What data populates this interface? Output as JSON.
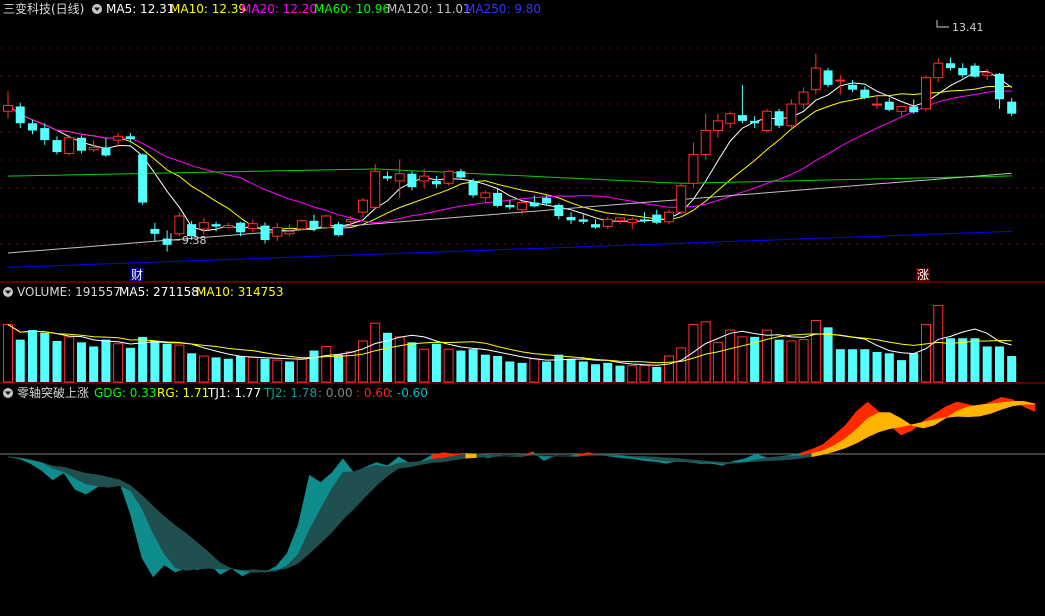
{
  "main_header": {
    "title": "三变科技(日线)",
    "items": [
      {
        "label": "MA5: 12.31",
        "color": "#ffffff"
      },
      {
        "label": "MA10: 12.39",
        "color": "#ffff00"
      },
      {
        "label": "MA20: 12.20",
        "color": "#ff00ff"
      },
      {
        "label": "MA60: 10.96",
        "color": "#00ff00"
      },
      {
        "label": "MA120: 11.01",
        "color": "#c0c0c0"
      },
      {
        "label": "MA250: 9.80",
        "color": "#0000ff"
      }
    ]
  },
  "volume_header": {
    "title": "VOLUME: 191557",
    "items": [
      {
        "label": "MA5: 271158",
        "color": "#ffffff"
      },
      {
        "label": "MA10: 314753",
        "color": "#ffff00"
      }
    ]
  },
  "indicator_header": {
    "title": "零轴突破上涨",
    "items": [
      {
        "label": "GDG: 0.33",
        "color": "#00ff00"
      },
      {
        "label": "RG: 1.71",
        "color": "#ffff00"
      },
      {
        "label": "TJ1: 1.77",
        "color": "#ffffff"
      },
      {
        "label": "TJ2: 1.78",
        "color": "#008080"
      },
      {
        "label": ": 0.00",
        "color": "#808080"
      },
      {
        "label": ": 0.60",
        "color": "#ff0000"
      },
      {
        "label": ": -0.60",
        "color": "#00c0c0"
      }
    ]
  },
  "markers": {
    "low_label": "9.38",
    "high_label": "13.41",
    "event_cai": "财",
    "event_zhang": "涨"
  },
  "colors": {
    "up": "#ff3030",
    "down": "#54ffff",
    "grid": "#7a0000",
    "frame": "#b00000",
    "zero": "#808080"
  },
  "chart_data": {
    "type": "candlestick",
    "price_range": [
      9.1,
      14.2
    ],
    "candles": [
      [
        12.3,
        12.72,
        12.15,
        12.42
      ],
      [
        12.4,
        12.48,
        11.95,
        12.05
      ],
      [
        12.05,
        12.12,
        11.82,
        11.9
      ],
      [
        11.95,
        12.05,
        11.6,
        11.7
      ],
      [
        11.7,
        11.78,
        11.4,
        11.45
      ],
      [
        11.42,
        11.82,
        11.38,
        11.75
      ],
      [
        11.75,
        11.8,
        11.42,
        11.48
      ],
      [
        11.5,
        11.7,
        11.45,
        11.55
      ],
      [
        11.55,
        11.75,
        11.35,
        11.38
      ],
      [
        11.7,
        11.85,
        11.55,
        11.78
      ],
      [
        11.78,
        11.85,
        11.65,
        11.72
      ],
      [
        11.4,
        11.42,
        10.35,
        10.4
      ],
      [
        9.85,
        9.98,
        9.6,
        9.75
      ],
      [
        9.65,
        9.82,
        9.38,
        9.52
      ],
      [
        9.75,
        10.2,
        9.7,
        10.12
      ],
      [
        9.95,
        10.02,
        9.62,
        9.7
      ],
      [
        9.85,
        10.08,
        9.72,
        9.98
      ],
      [
        9.95,
        10.0,
        9.8,
        9.9
      ],
      [
        9.88,
        9.98,
        9.85,
        9.92
      ],
      [
        9.98,
        10.0,
        9.7,
        9.78
      ],
      [
        9.86,
        10.05,
        9.78,
        9.96
      ],
      [
        9.92,
        9.99,
        9.55,
        9.62
      ],
      [
        9.7,
        9.98,
        9.6,
        9.88
      ],
      [
        9.75,
        9.95,
        9.7,
        9.8
      ],
      [
        9.85,
        10.05,
        9.82,
        10.02
      ],
      [
        10.02,
        10.15,
        9.8,
        9.85
      ],
      [
        9.88,
        10.15,
        9.85,
        10.12
      ],
      [
        9.95,
        10.0,
        9.7,
        9.72
      ],
      [
        10.0,
        10.12,
        9.9,
        10.05
      ],
      [
        10.2,
        10.5,
        10.1,
        10.45
      ],
      [
        10.3,
        11.2,
        10.25,
        11.05
      ],
      [
        10.95,
        11.05,
        10.85,
        10.9
      ],
      [
        10.85,
        11.3,
        10.5,
        11.0
      ],
      [
        11.0,
        11.05,
        10.65,
        10.72
      ],
      [
        10.85,
        11.1,
        10.7,
        10.95
      ],
      [
        10.85,
        10.95,
        10.7,
        10.78
      ],
      [
        10.8,
        11.08,
        10.75,
        11.05
      ],
      [
        11.05,
        11.1,
        10.9,
        10.92
      ],
      [
        10.85,
        10.9,
        10.5,
        10.55
      ],
      [
        10.5,
        10.65,
        10.4,
        10.6
      ],
      [
        10.6,
        10.7,
        10.3,
        10.33
      ],
      [
        10.35,
        10.45,
        10.25,
        10.3
      ],
      [
        10.25,
        10.42,
        10.15,
        10.4
      ],
      [
        10.4,
        10.55,
        10.3,
        10.32
      ],
      [
        10.5,
        10.55,
        10.35,
        10.38
      ],
      [
        10.35,
        10.38,
        10.05,
        10.12
      ],
      [
        10.1,
        10.2,
        9.95,
        10.03
      ],
      [
        10.05,
        10.15,
        9.95,
        10.0
      ],
      [
        9.95,
        10.05,
        9.85,
        9.88
      ],
      [
        9.9,
        10.1,
        9.85,
        10.05
      ],
      [
        10.02,
        10.1,
        9.95,
        10.08
      ],
      [
        9.98,
        10.1,
        9.85,
        10.05
      ],
      [
        10.05,
        10.2,
        9.98,
        10.02
      ],
      [
        10.15,
        10.25,
        9.95,
        9.98
      ],
      [
        10.0,
        10.25,
        9.95,
        10.2
      ],
      [
        10.2,
        10.8,
        10.15,
        10.75
      ],
      [
        10.8,
        11.65,
        10.7,
        11.4
      ],
      [
        11.4,
        12.25,
        11.3,
        11.9
      ],
      [
        11.9,
        12.25,
        11.75,
        12.1
      ],
      [
        12.05,
        12.3,
        11.95,
        12.25
      ],
      [
        12.22,
        12.85,
        12.05,
        12.1
      ],
      [
        12.1,
        12.2,
        11.95,
        12.05
      ],
      [
        11.9,
        12.35,
        11.85,
        12.3
      ],
      [
        12.3,
        12.35,
        11.95,
        12.0
      ],
      [
        12.0,
        12.55,
        11.95,
        12.45
      ],
      [
        12.45,
        12.8,
        12.35,
        12.7
      ],
      [
        12.75,
        13.5,
        12.65,
        13.2
      ],
      [
        13.15,
        13.2,
        12.8,
        12.85
      ],
      [
        12.95,
        13.05,
        12.65,
        12.95
      ],
      [
        12.85,
        12.95,
        12.7,
        12.75
      ],
      [
        12.75,
        12.82,
        12.55,
        12.58
      ],
      [
        12.45,
        12.6,
        12.35,
        12.45
      ],
      [
        12.5,
        12.58,
        12.3,
        12.33
      ],
      [
        12.3,
        12.42,
        12.2,
        12.4
      ],
      [
        12.4,
        12.55,
        12.25,
        12.28
      ],
      [
        12.35,
        13.05,
        12.3,
        13.0
      ],
      [
        13.0,
        13.41,
        12.9,
        13.3
      ],
      [
        13.3,
        13.42,
        13.15,
        13.2
      ],
      [
        13.2,
        13.3,
        13.0,
        13.05
      ],
      [
        13.25,
        13.3,
        13.0,
        13.02
      ],
      [
        13.05,
        13.18,
        12.95,
        13.1
      ],
      [
        13.08,
        13.1,
        12.35,
        12.55
      ],
      [
        12.5,
        12.58,
        12.2,
        12.25
      ]
    ],
    "volume_range": [
      0,
      600000
    ],
    "volume": [
      [
        420000,
        0
      ],
      [
        310000,
        1
      ],
      [
        380000,
        1
      ],
      [
        360000,
        1
      ],
      [
        300000,
        1
      ],
      [
        330000,
        0
      ],
      [
        290000,
        1
      ],
      [
        260000,
        1
      ],
      [
        310000,
        1
      ],
      [
        280000,
        0
      ],
      [
        250000,
        1
      ],
      [
        330000,
        1
      ],
      [
        300000,
        1
      ],
      [
        280000,
        1
      ],
      [
        270000,
        0
      ],
      [
        210000,
        1
      ],
      [
        190000,
        0
      ],
      [
        180000,
        1
      ],
      [
        170000,
        1
      ],
      [
        190000,
        1
      ],
      [
        180000,
        0
      ],
      [
        170000,
        1
      ],
      [
        160000,
        0
      ],
      [
        150000,
        1
      ],
      [
        170000,
        0
      ],
      [
        230000,
        1
      ],
      [
        260000,
        0
      ],
      [
        200000,
        1
      ],
      [
        220000,
        0
      ],
      [
        300000,
        0
      ],
      [
        430000,
        0
      ],
      [
        360000,
        1
      ],
      [
        330000,
        0
      ],
      [
        290000,
        1
      ],
      [
        240000,
        0
      ],
      [
        280000,
        1
      ],
      [
        240000,
        0
      ],
      [
        230000,
        1
      ],
      [
        240000,
        1
      ],
      [
        200000,
        1
      ],
      [
        190000,
        1
      ],
      [
        150000,
        1
      ],
      [
        140000,
        1
      ],
      [
        170000,
        0
      ],
      [
        150000,
        1
      ],
      [
        200000,
        1
      ],
      [
        170000,
        1
      ],
      [
        150000,
        1
      ],
      [
        130000,
        1
      ],
      [
        140000,
        1
      ],
      [
        120000,
        1
      ],
      [
        120000,
        0
      ],
      [
        120000,
        0
      ],
      [
        110000,
        1
      ],
      [
        190000,
        0
      ],
      [
        250000,
        0
      ],
      [
        420000,
        0
      ],
      [
        440000,
        0
      ],
      [
        290000,
        0
      ],
      [
        380000,
        0
      ],
      [
        330000,
        0
      ],
      [
        330000,
        1
      ],
      [
        380000,
        0
      ],
      [
        310000,
        1
      ],
      [
        300000,
        0
      ],
      [
        310000,
        0
      ],
      [
        450000,
        0
      ],
      [
        400000,
        1
      ],
      [
        240000,
        1
      ],
      [
        240000,
        1
      ],
      [
        240000,
        1
      ],
      [
        220000,
        1
      ],
      [
        210000,
        1
      ],
      [
        160000,
        1
      ],
      [
        210000,
        1
      ],
      [
        420000,
        0
      ],
      [
        560000,
        0
      ],
      [
        320000,
        1
      ],
      [
        320000,
        1
      ],
      [
        320000,
        1
      ],
      [
        260000,
        1
      ],
      [
        260000,
        1
      ],
      [
        190000,
        1
      ]
    ],
    "indicator_range": [
      -3.3,
      1.1
    ],
    "indicator": [
      -0.06,
      -0.1,
      -0.2,
      -0.35,
      -0.55,
      -0.4,
      -0.75,
      -0.85,
      -0.7,
      -0.52,
      -0.6,
      -1.3,
      -2.2,
      -2.6,
      -2.35,
      -2.5,
      -2.4,
      -2.45,
      -2.32,
      -2.55,
      -2.42,
      -2.58,
      -2.46,
      -2.5,
      -2.38,
      -2.1,
      -1.5,
      -0.45,
      -0.6,
      -0.4,
      -0.1,
      -0.4,
      -0.28,
      -0.18,
      -0.25,
      -0.06,
      -0.2,
      -0.15,
      -0.02,
      0.03,
      0.0,
      0.02,
      -0.03,
      -0.08,
      -0.03,
      -0.05,
      -0.05,
      0.05,
      -0.14,
      -0.03,
      -0.05,
      -0.01,
      0.03,
      -0.02,
      -0.05,
      -0.08,
      -0.1,
      -0.14,
      -0.16,
      -0.2,
      -0.14,
      -0.17,
      -0.2,
      -0.2,
      -0.24,
      -0.15,
      -0.1,
      0.0,
      -0.08,
      -0.06,
      -0.03,
      0.02,
      0.1,
      0.2,
      0.4,
      0.6,
      0.9,
      1.1,
      0.9,
      0.6,
      0.4,
      0.5,
      0.7,
      0.85,
      1.0,
      1.1,
      1.05,
      1.0,
      1.1,
      1.2,
      1.15,
      1.0,
      0.9
    ]
  }
}
